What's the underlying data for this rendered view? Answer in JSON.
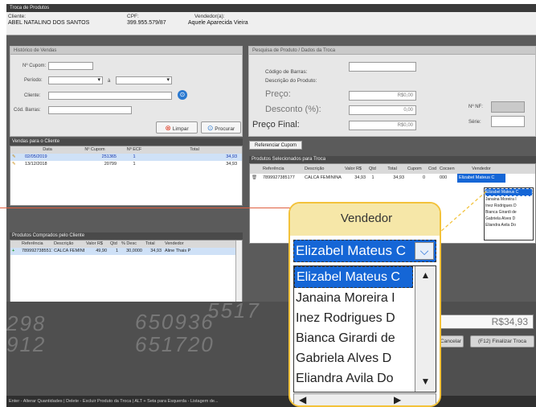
{
  "window": {
    "title": "Troca de Produtos"
  },
  "client_info": {
    "cliente_label": "Cliente:",
    "cliente_value": "ABEL NATALINO DOS SANTOS",
    "cpf_label": "CPF:",
    "cpf_value": "399.955.579/87",
    "vendedor_label": "Vendedor(a):",
    "vendedor_value": "Aquele Aparecida Vieira"
  },
  "historico": {
    "title": "Histórico de Vendas",
    "cupom_label": "Nº Cupom:",
    "periodo_label": "Período:",
    "periodo_sep": "à",
    "cliente_label": "Cliente:",
    "barras_label": "Cód. Barras:",
    "limpar_label": "Limpar",
    "procurar_label": "Procurar"
  },
  "pesquisa": {
    "title": "Pesquisa de Produto / Dados da Troca",
    "codigo_label": "Código de Barras:",
    "descricao_label": "Descrição do Produto:",
    "preco_label": "Preço:",
    "preco_value": "R$0,00",
    "desconto_label": "Desconto (%):",
    "desconto_value": "0,00",
    "preco_final_label": "Preço Final:",
    "preco_final_value": "R$0,00",
    "nf_label": "Nº NF:",
    "serie_label": "Série:"
  },
  "vendas_cliente": {
    "title": "Vendas para o Cliente",
    "columns": [
      "Data",
      "Nº Cupom",
      "Nº ECF",
      "Total"
    ],
    "rows": [
      [
        "02/05/2019",
        "251365",
        "1",
        "34,93"
      ],
      [
        "13/12/2018",
        "20799",
        "1",
        "34,93"
      ]
    ]
  },
  "referenciar_cupom": "Referenciar Cupom",
  "selecionados": {
    "title": "Produtos Selecionados para Troca",
    "columns": [
      "Referência",
      "Descrição",
      "Valor R$",
      "Qtd",
      "Total",
      "Cupom",
      "Cod",
      "Cocsen",
      "Vendedor"
    ],
    "row": [
      "7899927385177",
      "CALCA FEMININA",
      "34,93",
      "1",
      "34,93",
      "0",
      "",
      "000",
      "Elizabel Mateus C"
    ]
  },
  "comprados": {
    "title": "Produtos Comprados pelo Cliente",
    "columns": [
      "Referência",
      "Descrição",
      "Valor R$",
      "Qtd",
      "% Desc",
      "Total",
      "Vendedor"
    ],
    "row": [
      "7899927385517",
      "CALCA FEMINB",
      "49,90",
      "1",
      "30,0000",
      "34,93",
      "Aline Thais P"
    ]
  },
  "vendedor_dropdown": {
    "header": "Vendedor",
    "selected": "Elizabel Mateus C",
    "options": [
      "Elizabel Mateus C",
      "Janaina Moreira I",
      "Inez Rodrigues D",
      "Bianca Girardi de",
      "Gabriela Alves D",
      "Eliandra Avila Do"
    ]
  },
  "total_value": "R$34,93",
  "cancelar_label": "Cancelar",
  "finalizar_label": "(F12) Finalizar Troca",
  "background_digits": [
    "5517",
    "298",
    "650936",
    "912",
    "651720"
  ],
  "status_text": "Enter - Alterar Quantidades | Delete - Excluir Produto da Troca | ALT + Seta para Esquerda - Listagem de..."
}
